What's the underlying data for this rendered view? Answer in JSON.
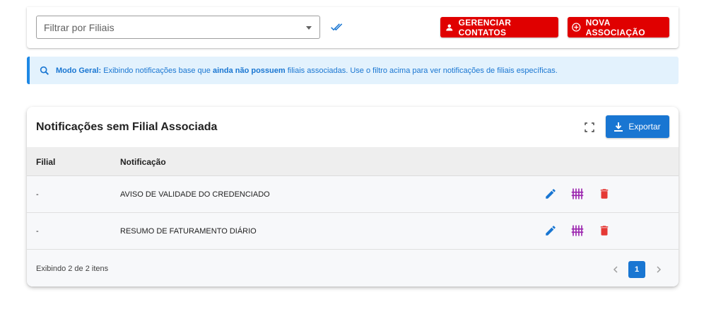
{
  "filter": {
    "placeholder": "Filtrar por Filiais",
    "select_all_icon": "double-check-icon"
  },
  "buttons": {
    "manage_contacts": "GERENCIAR CONTATOS",
    "new_association": "NOVA ASSOCIAÇÃO",
    "export": "Exportar"
  },
  "alert": {
    "label": "Modo Geral:",
    "text_before": " Exibindo notificações base que ",
    "text_bold": "ainda não possuem",
    "text_after": " filiais associadas. Use o filtro acima para ver notificações de filiais específicas."
  },
  "table": {
    "title": "Notificações sem Filial Associada",
    "columns": [
      "Filial",
      "Notificação"
    ],
    "rows": [
      {
        "filial": "-",
        "notificacao": "AVISO DE VALIDADE DO CREDENCIADO"
      },
      {
        "filial": "-",
        "notificacao": "RESUMO DE FATURAMENTO DIÁRIO"
      }
    ],
    "footer_text": "Exibindo 2 de 2 itens",
    "current_page": "1"
  },
  "colors": {
    "danger": "#e00000",
    "primary": "#1976d2",
    "edit_icon": "#1976d2",
    "contacts_icon": "#9c27b0",
    "delete_icon": "#e53935",
    "alert_bg": "#e3f2fd"
  }
}
